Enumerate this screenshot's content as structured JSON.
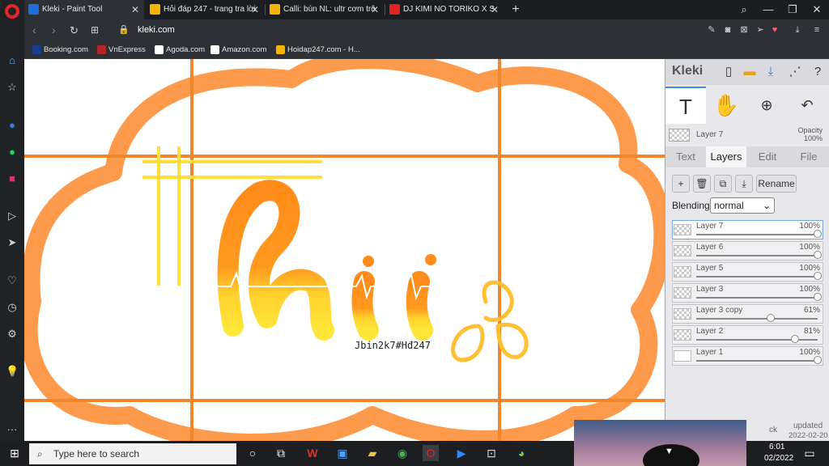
{
  "browser": {
    "tabs": [
      {
        "title": "Kleki - Paint Tool",
        "color": "#1e6fd9"
      },
      {
        "title": "Hỏi đáp 247 - trang tra lời",
        "color": "#f4b400"
      },
      {
        "title": "Calli: bùn NL: ultr cơm trô",
        "color": "#f4b400"
      },
      {
        "title": "DJ KIMI NO TORIKO X S",
        "color": "#e02424"
      }
    ],
    "url": "kleki.com",
    "bookmarks": [
      {
        "label": "Booking.com",
        "color": "#1a3e8f"
      },
      {
        "label": "VnExpress",
        "color": "#b2242a"
      },
      {
        "label": "Agoda.com",
        "color": "#ffffff"
      },
      {
        "label": "Amazon.com",
        "color": "#ffffff"
      },
      {
        "label": "Hoidap247.com - H...",
        "color": "#f4b400"
      }
    ]
  },
  "canvas": {
    "letters": "hii",
    "signature": "Jbin2k7#Hđ247",
    "colors": {
      "cloud": "#fd9a4c",
      "grid": "#f2862a",
      "yellow": "#ffe03a",
      "orange": "#ff8c1a"
    }
  },
  "kleki": {
    "brand": "Kleki",
    "current_layer": "Layer 7",
    "opacity_label": "Opacity",
    "opacity_value": "100%",
    "tabs": [
      "Text",
      "Layers",
      "Edit",
      "File"
    ],
    "rename": "Rename",
    "blending_label": "Blending",
    "blending_value": "normal",
    "layers": [
      {
        "name": "Layer 7",
        "opacity": "100%",
        "value": 1.0
      },
      {
        "name": "Layer 6",
        "opacity": "100%",
        "value": 1.0
      },
      {
        "name": "Layer 5",
        "opacity": "100%",
        "value": 1.0
      },
      {
        "name": "Layer 3",
        "opacity": "100%",
        "value": 1.0
      },
      {
        "name": "Layer 3 copy",
        "opacity": "61%",
        "value": 0.61
      },
      {
        "name": "Layer 2",
        "opacity": "81%",
        "value": 0.81
      },
      {
        "name": "Layer 1",
        "opacity": "100%",
        "value": 1.0
      }
    ],
    "updated_label": "updated",
    "updated_date": "2022-02-20",
    "back_fragment": "ck"
  },
  "taskbar": {
    "search_placeholder": "Type here to search",
    "time": "6:01",
    "date": "02/2022"
  }
}
